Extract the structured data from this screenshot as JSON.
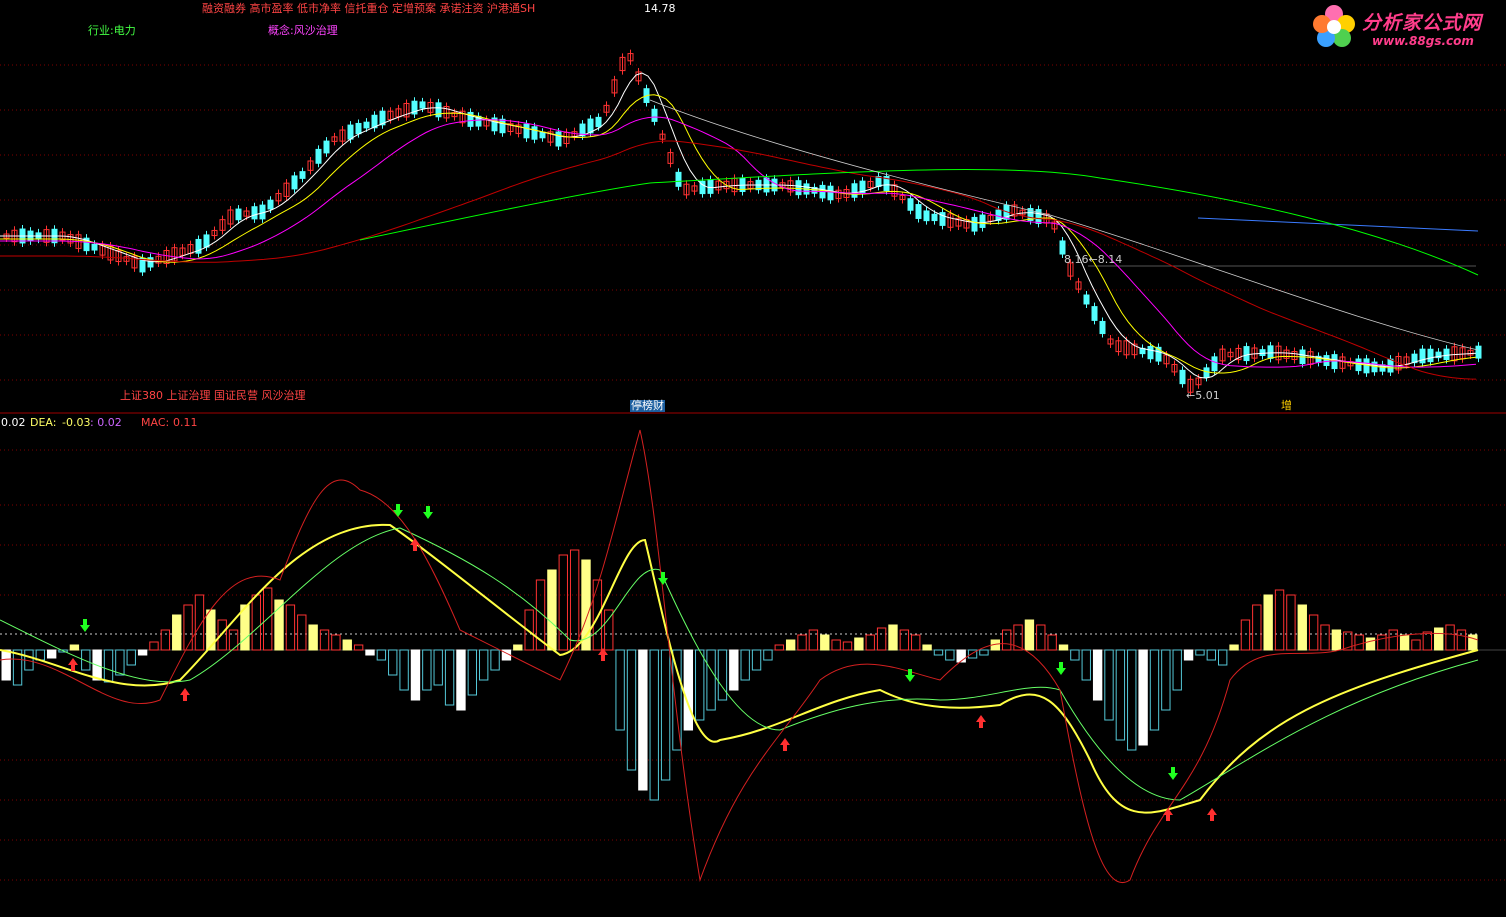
{
  "header": {
    "margin_tags": "融资融券 高市盈率 低市净率 信托重仓 定增预案 承诺注资 沪港通SH",
    "industry": "行业:电力",
    "concept": "概念:风沙治理",
    "peak_label": "14.78",
    "index_tags": "上证380 上证治理 国证民营 风沙治理"
  },
  "logo": {
    "title": "分析家公式网",
    "url": "www.88gs.com"
  },
  "annotations": {
    "range_label": "8.16←8.14",
    "low_label": "←5.01",
    "tag_stop": "停榜财",
    "tag_inc": "增"
  },
  "macd": {
    "diff_value": "0.02",
    "dea_label": "DEA:",
    "dea_value": "-0.03",
    "dea_value2": ": 0.02",
    "mac_label": "MAC:",
    "mac_value": "0.11"
  },
  "colors": {
    "up": "#ff3232",
    "down": "#54ffff",
    "ma5": "#ffffff",
    "ma10": "#ffff00",
    "ma20": "#ff00ff",
    "ma60": "#00ff00",
    "ma120": "#c00000",
    "grid": "#800000",
    "hist_pos": "#ff3232",
    "hist_neg": "#54c8d8"
  }
}
